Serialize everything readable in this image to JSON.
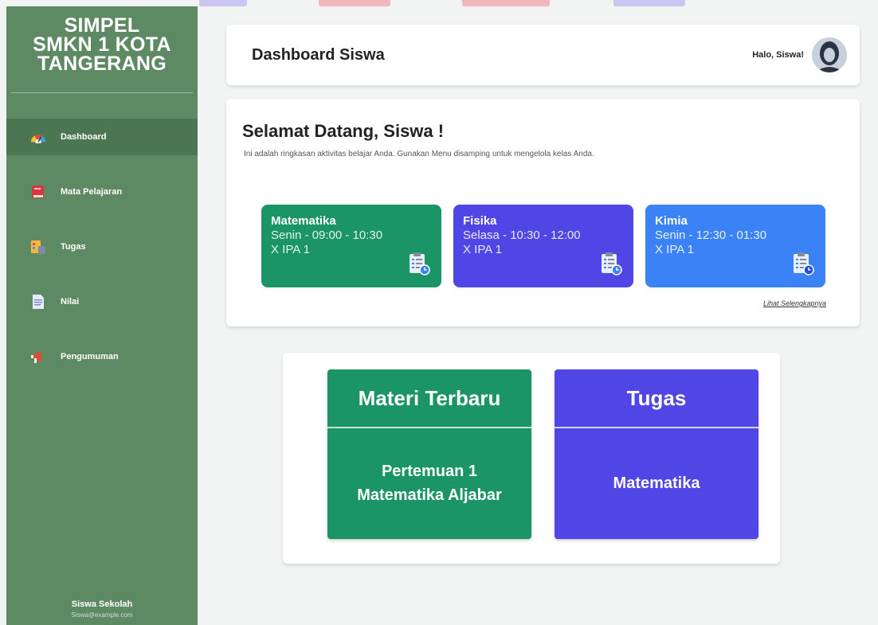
{
  "sidebar": {
    "brand": [
      "SIMPEL",
      "SMKN 1 KOTA",
      "TANGERANG"
    ],
    "items": [
      {
        "label": "Dashboard",
        "icon": "dashboard-gauge-icon",
        "active": true
      },
      {
        "label": "Mata Pelajaran",
        "icon": "book-icon",
        "active": false
      },
      {
        "label": "Tugas",
        "icon": "tasks-icon",
        "active": false
      },
      {
        "label": "Nilai",
        "icon": "document-icon",
        "active": false
      },
      {
        "label": "Pengumuman",
        "icon": "megaphone-icon",
        "active": false
      }
    ],
    "user": {
      "name": "Siswa Sekolah",
      "email": "Siswa@example.com"
    }
  },
  "header": {
    "title": "Dashboard Siswa",
    "greeting": "Halo, Siswa!"
  },
  "welcome": {
    "title": "Selamat Datang, Siswa !",
    "subtitle": "Ini adalah ringkasan aktivitas belajar Anda. Gunakan Menu disamping untuk mengelola kelas Anda.",
    "more_link": "Lihat Selengkapnya"
  },
  "courses": [
    {
      "name": "Matematika",
      "time": "Senin - 09:00 - 10:30",
      "class": "X IPA 1",
      "color": "#1b9466"
    },
    {
      "name": "Fisika",
      "time": "Selasa - 10:30 - 12:00",
      "class": "X IPA 1",
      "color": "#4f46e5"
    },
    {
      "name": "Kimia",
      "time": "Senin - 12:30 - 01:30",
      "class": "X IPA 1",
      "color": "#3b82f6"
    }
  ],
  "cards": {
    "materi": {
      "title": "Materi Terbaru",
      "line1": "Pertemuan 1",
      "line2": "Matematika Aljabar",
      "color": "#1b9466"
    },
    "tugas": {
      "title": "Tugas",
      "line1": "Matematika",
      "color": "#4f46e5"
    }
  }
}
